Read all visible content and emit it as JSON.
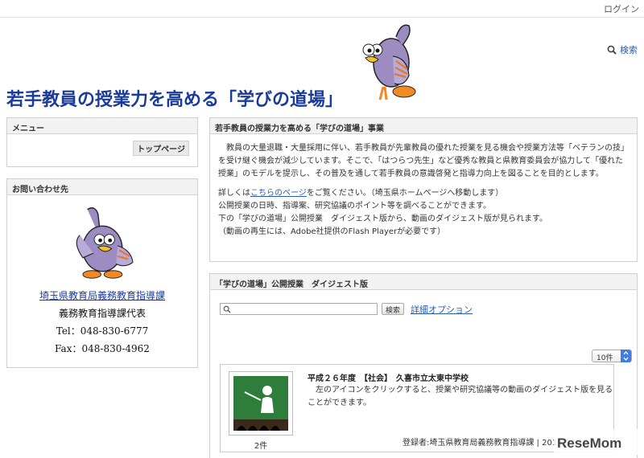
{
  "header": {
    "login": "ログイン",
    "search": "検索",
    "title": "若手教員の授業力を高める「学びの道場」"
  },
  "menu": {
    "heading": "メニュー",
    "items": [
      {
        "label": "トップページ"
      }
    ]
  },
  "contact": {
    "heading": "お問い合わせ先",
    "link": "埼玉県教育局義務教育指導課",
    "line1": "義務教育指導課代表",
    "tel": "Tel：048-830-6777",
    "fax": "Fax：048-830-4962"
  },
  "intro": {
    "heading": "若手教員の授業力を高める「学びの道場」事業",
    "para": "教員の大量退職・大量採用に伴い、若手教員が先輩教員の優れた授業を見る機会や授業方法等「ベテランの技」を受け継ぐ機会が減少しています。そこで、「はつらつ先生」など優秀な教員と県教育委員会が協力して「優れた授業」のモデルを提示し、その普及を通して若手教員の意識啓発と指導力向上を図ることを目的とします。",
    "detail_pre": "詳しくは",
    "detail_link": "こちらのページ",
    "detail_post": "をご覧ください。（埼玉県ホームページへ移動します）",
    "line2": "公開授業の日時、指導案、研究協議のポイント等を調べることができます。",
    "line3": "下の「学びの道場」公開授業　ダイジェスト版から、動画のダイジェスト版が見られます。",
    "line4": "（動画の再生には、Adobe社提供のFlash Playerが必要です）"
  },
  "digest": {
    "heading": "「学びの道場」公開授業　ダイジェスト版",
    "search_placeholder": "",
    "search_button": "検索",
    "advanced": "詳細オプション",
    "per_page": "10件",
    "item": {
      "title": "平成２６年度　【社会】　久喜市立太東中学校",
      "desc": "左のアイコンをクリックすると、授業や研究協議等の動画のダイジェスト版を見ることができます。",
      "count": "2件",
      "meta": "登録者:埼玉県教育局義務教育指導課 | 2015/07/15"
    }
  },
  "watermark": {
    "text": "ReseMom"
  },
  "colors": {
    "title": "#1a3a9c",
    "link": "#2a5db0",
    "mascot": "#9d8cc2",
    "accent": "#f08a24"
  }
}
